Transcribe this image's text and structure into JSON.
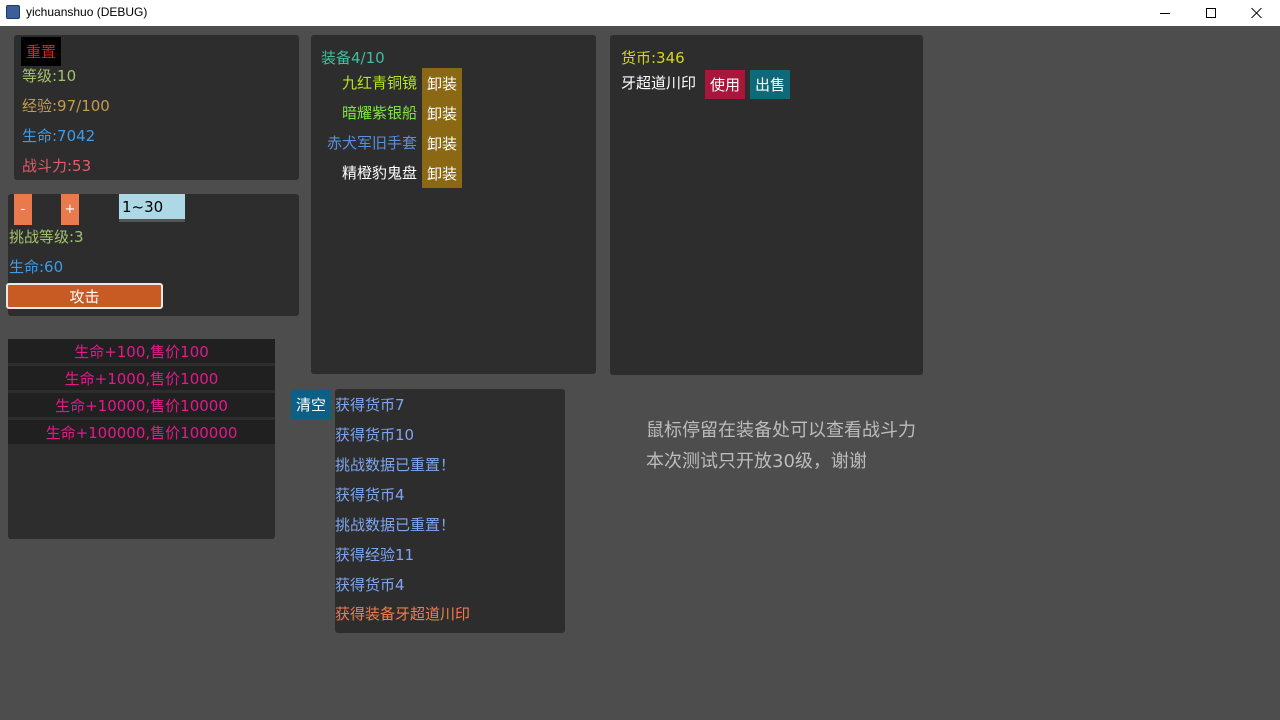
{
  "window": {
    "title": "yichuanshuo (DEBUG)"
  },
  "stats": {
    "reset_label": "重置",
    "level": "等级:10",
    "exp": "经验:97/100",
    "hp": "生命:7042",
    "power": "战斗力:53"
  },
  "challenge": {
    "minus_label": "-",
    "plus_label": "+",
    "range_value": "1~30",
    "level": "挑战等级:3",
    "hp": "生命:60",
    "attack_label": "攻击"
  },
  "shop": {
    "items": [
      "生命+100,售价100",
      "生命+1000,售价1000",
      "生命+10000,售价10000",
      "生命+100000,售价100000"
    ]
  },
  "equipment": {
    "header": "装备4/10",
    "unequip_label": "卸装",
    "items": [
      {
        "name": "九红青铜镜",
        "color": "#b5e61d"
      },
      {
        "name": "暗耀紫银船",
        "color": "#7ee83a"
      },
      {
        "name": "赤犬军旧手套",
        "color": "#5b8fd9"
      },
      {
        "name": "精橙豹鬼盘",
        "color": "#ffffff"
      }
    ]
  },
  "inventory": {
    "currency": "货币:346",
    "item_name": "牙超道川印",
    "use_label": "使用",
    "sell_label": "出售"
  },
  "log": {
    "clear_label": "清空",
    "entries": [
      "获得货币7",
      "获得货币10",
      "挑战数据已重置！",
      "获得货币4",
      "挑战数据已重置！",
      "获得经验11",
      "获得货币4",
      "获得装备牙超道川印"
    ]
  },
  "hint": {
    "line1": "鼠标停留在装备处可以查看战斗力",
    "line2": "本次测试只开放30级，谢谢"
  },
  "colors": {
    "background": "#4d4d4d",
    "panel": "#2d2d2d",
    "level_text": "#a3c26b",
    "exp_text": "#c39b4b",
    "hp_text": "#3d9be9",
    "power_text": "#e85a6b",
    "shop_text": "#e21a8c",
    "unequip_bg": "#8b6914",
    "use_bg": "#a8163c",
    "sell_bg": "#0e6a78",
    "clear_bg": "#0e5f86",
    "log_text": "#7ea6f0",
    "log_highlight": "#f07b4f",
    "orange_btn": "#e87a4d",
    "attack_bg": "#c85a24",
    "range_bg": "#add8e6",
    "hint_text": "#bcbcbc"
  }
}
